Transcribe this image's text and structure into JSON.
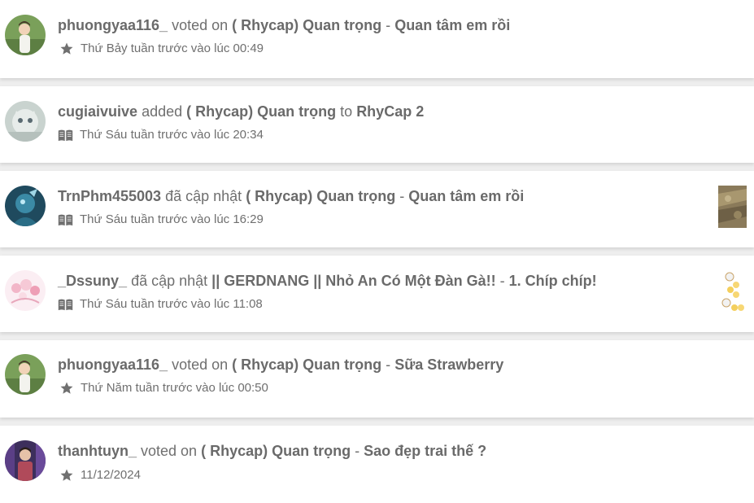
{
  "feed": [
    {
      "user": "phuongyaa116_",
      "action": "voted on",
      "story": "( Rhycap) Quan trọng",
      "sep": "-",
      "target": "Quan tâm em rồi",
      "icon": "star-icon",
      "time": "Thứ Bảy tuần trước vào lúc 00:49"
    },
    {
      "user": "cugiaivuive",
      "action": "added",
      "story": "( Rhycap) Quan trọng",
      "sep": "to",
      "target": "RhyCap 2",
      "icon": "book-icon",
      "time": "Thứ Sáu tuần trước vào lúc 20:34"
    },
    {
      "user": "TrnPhm455003",
      "action": "đã cập nhật",
      "story": "( Rhycap) Quan trọng",
      "sep": "-",
      "target": "Quan tâm em rồi",
      "icon": "book-icon",
      "time": "Thứ Sáu tuần trước vào lúc 16:29"
    },
    {
      "user": "_Dssuny_",
      "action": "đã cập nhật",
      "story": "|| GERDNANG || Nhỏ An Có Một Đàn Gà!!",
      "sep": "-",
      "target": "1. Chíp chíp!",
      "icon": "book-icon",
      "time": "Thứ Sáu tuần trước vào lúc 11:08"
    },
    {
      "user": "phuongyaa116_",
      "action": "voted on",
      "story": "( Rhycap) Quan trọng",
      "sep": "-",
      "target": "Sữa Strawberry",
      "icon": "star-icon",
      "time": "Thứ Năm tuần trước vào lúc 00:50"
    },
    {
      "user": "thanhtuyn_",
      "action": "voted on",
      "story": "( Rhycap) Quan trọng",
      "sep": "-",
      "target": "Sao đẹp trai thế ?",
      "icon": "star-icon",
      "time": "11/12/2024"
    }
  ],
  "colors": {
    "text": "#6f6f6f",
    "card": "#ffffff",
    "background": "#eeeeee"
  }
}
